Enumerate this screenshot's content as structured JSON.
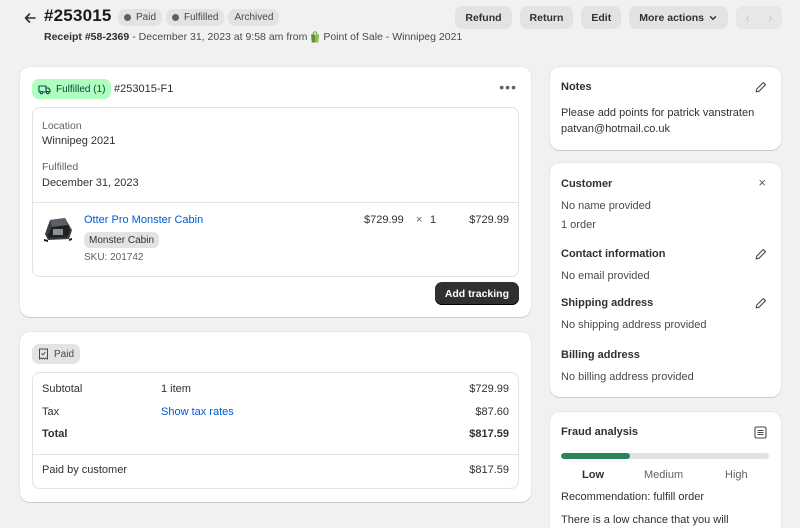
{
  "header": {
    "order_number": "#253015",
    "badges": [
      {
        "label": "Paid",
        "has_dot": true
      },
      {
        "label": "Fulfilled",
        "has_dot": true
      },
      {
        "label": "Archived",
        "has_dot": false
      }
    ],
    "receipt": "Receipt #58-2369",
    "date_text": "- December 31, 2023 at 9:58 am from",
    "source": "Point of Sale - Winnipeg 2021",
    "buttons": {
      "refund": "Refund",
      "return": "Return",
      "edit": "Edit",
      "more_actions": "More actions"
    },
    "pager": {
      "prev": "‹",
      "next": "›"
    }
  },
  "fulfillment": {
    "status": "Fulfilled (1)",
    "id": "#253015-F1",
    "location_label": "Location",
    "location_value": "Winnipeg 2021",
    "fulfilled_label": "Fulfilled",
    "fulfilled_value": "December 31, 2023",
    "item": {
      "name": "Otter Pro Monster Cabin",
      "variant": "Monster Cabin",
      "sku": "SKU: 201742",
      "price": "$729.99",
      "times": "×",
      "quantity": "1",
      "total": "$729.99"
    },
    "add_tracking": "Add tracking"
  },
  "payment": {
    "status": "Paid",
    "subtotal_label": "Subtotal",
    "subtotal_items": "1 item",
    "subtotal_value": "$729.99",
    "tax_label": "Tax",
    "tax_link": "Show tax rates",
    "tax_value": "$87.60",
    "total_label": "Total",
    "total_value": "$817.59",
    "paid_label": "Paid by customer",
    "paid_value": "$817.59"
  },
  "notes": {
    "title": "Notes",
    "line1": "Please add points for patrick vanstraten",
    "line2": "patvan@hotmail.co.uk"
  },
  "customer": {
    "title": "Customer",
    "close": "×",
    "name": "No name provided",
    "orders": "1 order",
    "contact_title": "Contact information",
    "contact_value": "No email provided",
    "shipping_title": "Shipping address",
    "shipping_value": "No shipping address provided",
    "billing_title": "Billing address",
    "billing_value": "No billing address provided"
  },
  "fraud": {
    "title": "Fraud analysis",
    "levels": [
      "Low",
      "Medium",
      "High"
    ],
    "level_value": 0.33,
    "recommendation": "Recommendation: fulfill order",
    "description": "There is a low chance that you will"
  },
  "colors": {
    "accent_link": "#005bd3",
    "fulfilled_bg": "#affebf",
    "risk_low": "#29845a",
    "primary_button": "#303030"
  }
}
